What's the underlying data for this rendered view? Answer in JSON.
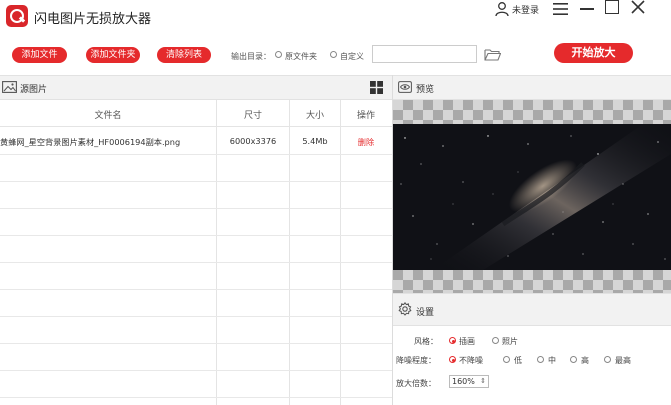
{
  "app": {
    "title": "闪电图片无损放大器",
    "login": "未登录"
  },
  "toolbar": {
    "add_file": "添加文件",
    "add_folder": "添加文件夹",
    "clear_list": "清除列表",
    "output_label": "输出目录：",
    "output_options": [
      "原文件夹",
      "自定义"
    ],
    "output_selected": "原文件夹",
    "output_path": "",
    "start": "开始放大"
  },
  "source": {
    "title": "源图片",
    "columns": [
      "文件名",
      "尺寸",
      "大小",
      "操作"
    ],
    "rows": [
      {
        "name": "黄蜂网_星空背景图片素材_HF0006194副本.png",
        "size": "6000x3376",
        "bytes": "5.4Mb",
        "action": "删除"
      }
    ]
  },
  "preview": {
    "title": "预览"
  },
  "settings": {
    "title": "设置",
    "style_label": "风格：",
    "style_options": [
      "插画",
      "照片"
    ],
    "style_selected": "插画",
    "noise_label": "降噪程度：",
    "noise_options": [
      "不降噪",
      "低",
      "中",
      "高",
      "最高"
    ],
    "noise_selected": "不降噪",
    "scale_label": "放大倍数：",
    "scale_value": "160%"
  },
  "colors": {
    "accent": "#e52a2c"
  }
}
